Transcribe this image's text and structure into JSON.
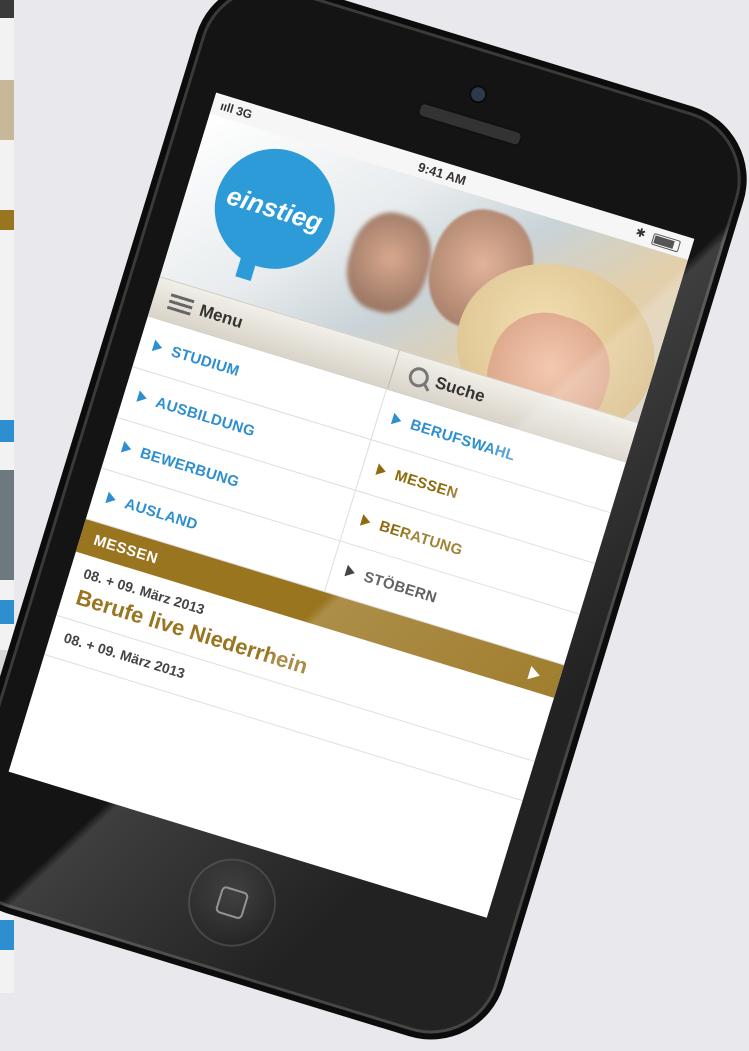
{
  "status": {
    "signal": "ııll 3G",
    "time": "9:41 AM",
    "bluetooth": "✱"
  },
  "brand": {
    "logo_text": "einstieg"
  },
  "bar": {
    "menu_label": "Menu",
    "search_label": "Suche"
  },
  "nav": {
    "left": [
      "STUDIUM",
      "AUSBILDUNG",
      "BEWERBUNG",
      "AUSLAND"
    ],
    "right": [
      "BERUFSWAHL",
      "MESSEN",
      "BERATUNG",
      "STÖBERN"
    ]
  },
  "section": {
    "title": "MESSEN"
  },
  "events": [
    {
      "date": "08. + 09. März 2013",
      "title": "Berufe live Niederrhein"
    },
    {
      "date": "08. + 09. März 2013",
      "title": ""
    }
  ],
  "colors": {
    "accent_blue": "#2d8fd0",
    "accent_gold": "#9a7520"
  }
}
